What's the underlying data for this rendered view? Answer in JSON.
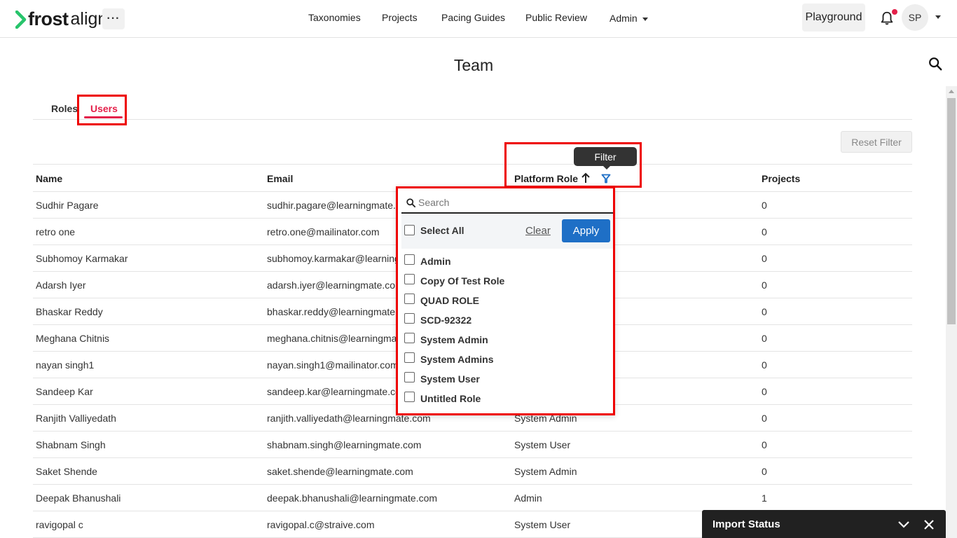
{
  "brand": {
    "name_bold": "frost",
    "name_light": "align",
    "accent": "#27c46b"
  },
  "header": {
    "more_label": "···",
    "nav": [
      "Taxonomies",
      "Projects",
      "Pacing Guides",
      "Public Review",
      "Admin"
    ],
    "playground_label": "Playground",
    "avatar_initials": "SP",
    "notification_dot_color": "#e4204a"
  },
  "page": {
    "title": "Team"
  },
  "tabs": {
    "roles": "Roles",
    "users": "Users",
    "active": "Users",
    "active_color": "#e4204a"
  },
  "toolbar": {
    "reset_filter": "Reset Filter"
  },
  "table": {
    "columns": [
      "Name",
      "Email",
      "Platform Role",
      "Projects"
    ],
    "sort": {
      "column": "Platform Role",
      "direction": "ascending"
    },
    "rows": [
      {
        "name": "Sudhir Pagare",
        "email": "sudhir.pagare@learningmate.c",
        "role": "",
        "projects": "0"
      },
      {
        "name": "retro one",
        "email": "retro.one@mailinator.com",
        "role": "",
        "projects": "0"
      },
      {
        "name": "Subhomoy Karmakar",
        "email": "subhomoy.karmakar@learning",
        "role": "",
        "projects": "0"
      },
      {
        "name": "Adarsh Iyer",
        "email": "adarsh.iyer@learningmate.com",
        "role": "",
        "projects": "0"
      },
      {
        "name": "Bhaskar Reddy",
        "email": "bhaskar.reddy@learningmate.",
        "role": "",
        "projects": "0"
      },
      {
        "name": "Meghana Chitnis",
        "email": "meghana.chitnis@learningmat",
        "role": "",
        "projects": "0"
      },
      {
        "name": "nayan singh1",
        "email": "nayan.singh1@mailinator.com",
        "role": "",
        "projects": "0"
      },
      {
        "name": "Sandeep Kar",
        "email": "sandeep.kar@learningmate.co",
        "role": "",
        "projects": "0"
      },
      {
        "name": "Ranjith Valliyedath",
        "email": "ranjith.valliyedath@learningmate.com",
        "role": "System Admin",
        "projects": "0"
      },
      {
        "name": "Shabnam Singh",
        "email": "shabnam.singh@learningmate.com",
        "role": "System User",
        "projects": "0"
      },
      {
        "name": "Saket Shende",
        "email": "saket.shende@learningmate.com",
        "role": "System Admin",
        "projects": "0"
      },
      {
        "name": "Deepak Bhanushali",
        "email": "deepak.bhanushali@learningmate.com",
        "role": "Admin",
        "projects": "1"
      },
      {
        "name": "ravigopal c",
        "email": "ravigopal.c@straive.com",
        "role": "System User",
        "projects": ""
      }
    ]
  },
  "filter": {
    "tooltip": "Filter",
    "search_placeholder": "Search",
    "select_all": "Select All",
    "clear": "Clear",
    "apply": "Apply",
    "apply_color": "#1e6fc6",
    "options": [
      "Admin",
      "Copy Of Test Role",
      "QUAD ROLE",
      "SCD-92322",
      "System Admin",
      "System Admins",
      "System User",
      "Untitled Role"
    ]
  },
  "import_status": {
    "title": "Import Status"
  }
}
